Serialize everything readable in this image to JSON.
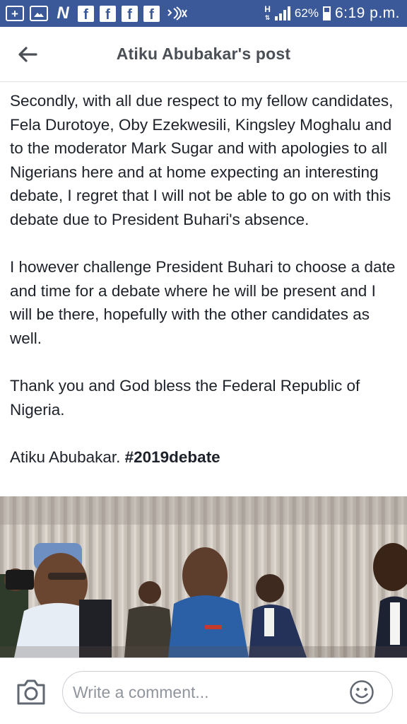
{
  "status_bar": {
    "battery_percent": "62%",
    "time": "6:19 p.m.",
    "network_type": "H",
    "notification_icons": [
      "add-box-icon",
      "image-icon",
      "n-icon",
      "facebook-icon",
      "facebook-icon",
      "facebook-icon",
      "facebook-icon",
      "wifi-icon"
    ]
  },
  "header": {
    "title": "Atiku Abubakar's post"
  },
  "post": {
    "paragraph_1": "Secondly, with all due respect to my fellow candidates, Fela Durotoye, Oby Ezekwesili, Kingsley Moghalu and to the moderator Mark Sugar and with apologies to all Nigerians here and at home expecting an interesting debate, I regret that I will not be able to go on with this debate due to President Buhari's absence.",
    "paragraph_2": "I however challenge President Buhari to choose a date and time for a debate where he will be present and I will be there, hopefully with the other candidates as well.",
    "paragraph_3": "Thank you and God bless the Federal Republic of Nigeria.",
    "signature": "Atiku Abubakar. ",
    "hashtag": "#2019debate"
  },
  "comment_bar": {
    "placeholder": "Write a comment..."
  },
  "colors": {
    "status_bar_bg": "#3b5998",
    "text": "#1d2129",
    "header_title": "#4b4f56",
    "placeholder": "#90949c"
  }
}
